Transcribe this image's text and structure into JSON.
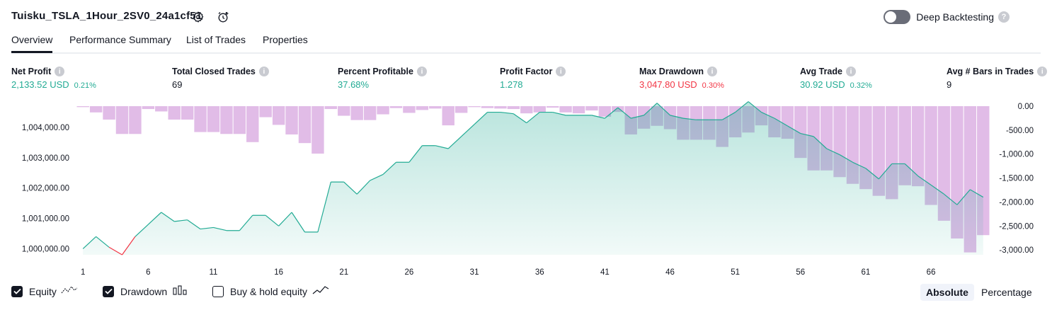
{
  "header": {
    "strategy_name": "Tuisku_TSLA_1Hour_2SV0_24a1cf51",
    "deep_backtesting_label": "Deep Backtesting",
    "deep_backtesting_enabled": false
  },
  "tabs": [
    {
      "label": "Overview",
      "active": true
    },
    {
      "label": "Performance Summary",
      "active": false
    },
    {
      "label": "List of Trades",
      "active": false
    },
    {
      "label": "Properties",
      "active": false
    }
  ],
  "metrics": [
    {
      "label": "Net Profit",
      "value": "2,133.52 USD",
      "pct": "0.21%",
      "color": "green"
    },
    {
      "label": "Total Closed Trades",
      "value": "69",
      "pct": "",
      "color": "dark"
    },
    {
      "label": "Percent Profitable",
      "value": "37.68%",
      "pct": "",
      "color": "green"
    },
    {
      "label": "Profit Factor",
      "value": "1.278",
      "pct": "",
      "color": "green"
    },
    {
      "label": "Max Drawdown",
      "value": "3,047.80 USD",
      "pct": "0.30%",
      "color": "red"
    },
    {
      "label": "Avg Trade",
      "value": "30.92 USD",
      "pct": "0.32%",
      "color": "green"
    },
    {
      "label": "Avg # Bars in Trades",
      "value": "9",
      "pct": "",
      "color": "dark"
    }
  ],
  "chart_data": {
    "type": "area",
    "x": [
      1,
      2,
      3,
      4,
      5,
      6,
      7,
      8,
      9,
      10,
      11,
      12,
      13,
      14,
      15,
      16,
      17,
      18,
      19,
      20,
      21,
      22,
      23,
      24,
      25,
      26,
      27,
      28,
      29,
      30,
      31,
      32,
      33,
      34,
      35,
      36,
      37,
      38,
      39,
      40,
      41,
      42,
      43,
      44,
      45,
      46,
      47,
      48,
      49,
      50,
      51,
      52,
      53,
      54,
      55,
      56,
      57,
      58,
      59,
      60,
      61,
      62,
      63,
      64,
      65,
      66,
      67,
      68,
      69,
      70
    ],
    "x_ticks": [
      "1",
      "6",
      "11",
      "16",
      "21",
      "26",
      "31",
      "36",
      "41",
      "46",
      "51",
      "56",
      "61",
      "66"
    ],
    "y_left_ticks": [
      "1,000,000.00",
      "1,001,000.00",
      "1,002,000.00",
      "1,003,000.00",
      "1,004,000.00"
    ],
    "y_left_range": [
      999800,
      1004700
    ],
    "y_right_ticks": [
      "0.00",
      "-500.00",
      "-1,000.00",
      "-1,500.00",
      "-2,000.00",
      "-2,500.00",
      "-3,000.00"
    ],
    "y_right_range": [
      -3100,
      0
    ],
    "series": [
      {
        "name": "Equity",
        "color": "#22ab94",
        "negative_color": "#f23645",
        "values": [
          1000000,
          1000400,
          1000050,
          999800,
          1000400,
          1000800,
          1001200,
          1000900,
          1000950,
          1000650,
          1000700,
          1000600,
          1000600,
          1001100,
          1001100,
          1000750,
          1001200,
          1000550,
          1000550,
          1002200,
          1002200,
          1001800,
          1002250,
          1002450,
          1002850,
          1002850,
          1003400,
          1003400,
          1003300,
          1003700,
          1004100,
          1004500,
          1004500,
          1004450,
          1004150,
          1004500,
          1004500,
          1004400,
          1004400,
          1004400,
          1004300,
          1004650,
          1004300,
          1004400,
          1004800,
          1004400,
          1004300,
          1004250,
          1004250,
          1004250,
          1004500,
          1004850,
          1004500,
          1004300,
          1004050,
          1003800,
          1003700,
          1003300,
          1003100,
          1002850,
          1002650,
          1002300,
          1002800,
          1002800,
          1002400,
          1002100,
          1001800,
          1001450,
          1001950,
          1001700
        ]
      },
      {
        "name": "Drawdown",
        "color": "#ce93d8",
        "values": [
          -20,
          -130,
          -280,
          -580,
          -580,
          -60,
          -110,
          -280,
          -280,
          -540,
          -540,
          -580,
          -580,
          -750,
          -230,
          -390,
          -590,
          -770,
          -990,
          -60,
          -200,
          -290,
          -290,
          -170,
          -40,
          -140,
          -80,
          -50,
          -400,
          -140,
          -20,
          -40,
          -50,
          -60,
          -150,
          -130,
          -30,
          -130,
          -150,
          -90,
          -220,
          -120,
          -590,
          -470,
          -410,
          -480,
          -700,
          -700,
          -700,
          -850,
          -650,
          -550,
          -400,
          -650,
          -680,
          -1080,
          -1340,
          -1340,
          -1480,
          -1620,
          -1730,
          -1870,
          -1940,
          -1650,
          -1670,
          -2060,
          -2390,
          -2760,
          -3050,
          -2690
        ]
      }
    ],
    "legend": [
      {
        "label": "Equity",
        "checked": true,
        "icon": "equity-line-icon"
      },
      {
        "label": "Drawdown",
        "checked": true,
        "icon": "drawdown-bars-icon"
      },
      {
        "label": "Buy & hold equity",
        "checked": false,
        "icon": "buy-hold-line-icon"
      }
    ],
    "grid": false
  },
  "scale_toggle": {
    "absolute_label": "Absolute",
    "percentage_label": "Percentage",
    "active": "absolute"
  }
}
